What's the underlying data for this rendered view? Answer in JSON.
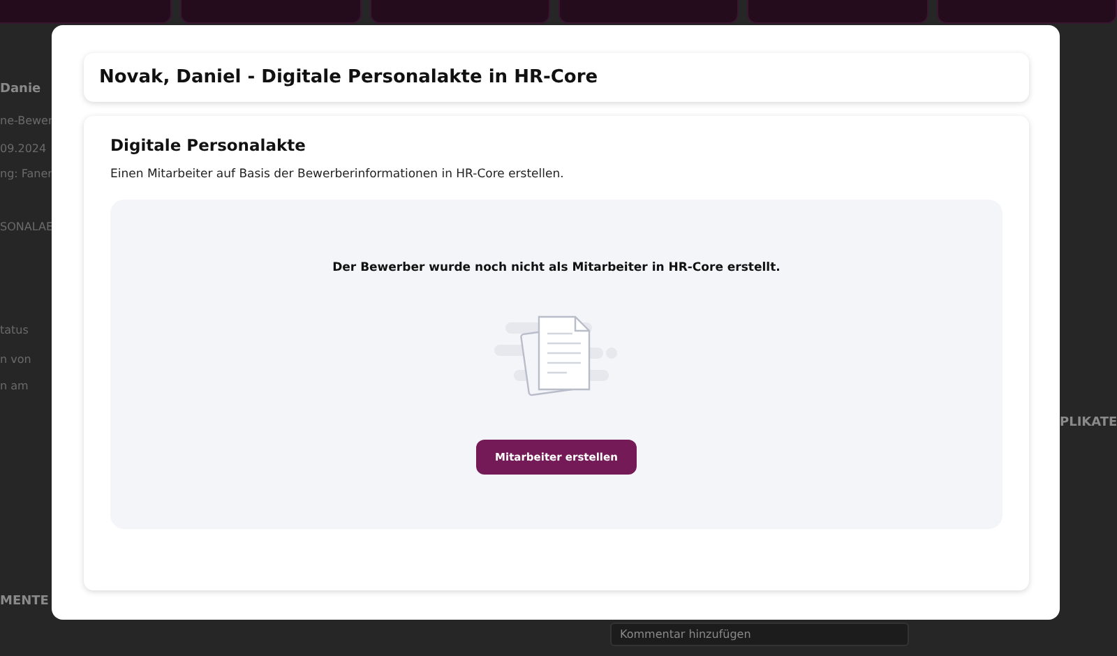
{
  "background": {
    "left_texts": [
      {
        "text": "Danie",
        "kind": "heading"
      },
      {
        "text": "ne-Bewer",
        "kind": "text"
      },
      {
        "text": "09.2024",
        "kind": "text"
      },
      {
        "text": "ng: Fanen",
        "kind": "text"
      },
      {
        "text": "SONALAE",
        "kind": "text"
      },
      {
        "text": "tatus",
        "kind": "text"
      },
      {
        "text": "n von",
        "kind": "text"
      },
      {
        "text": "n am",
        "kind": "text"
      },
      {
        "text": "MENTE",
        "kind": "heading"
      }
    ],
    "right_texts": [
      {
        "text": "PLIKATE",
        "kind": "heading"
      }
    ],
    "bottom_text": "Kommentar hinzufügen"
  },
  "modal": {
    "title": "Novak, Daniel - Digitale Personalakte in HR-Core",
    "section_title": "Digitale Personalakte",
    "description": "Einen Mitarbeiter auf Basis der Bewerberinformationen in HR-Core erstellen.",
    "empty_message": "Der Bewerber wurde noch nicht als Mitarbeiter in HR-Core erstellt.",
    "button": "Mitarbeiter erstellen"
  }
}
